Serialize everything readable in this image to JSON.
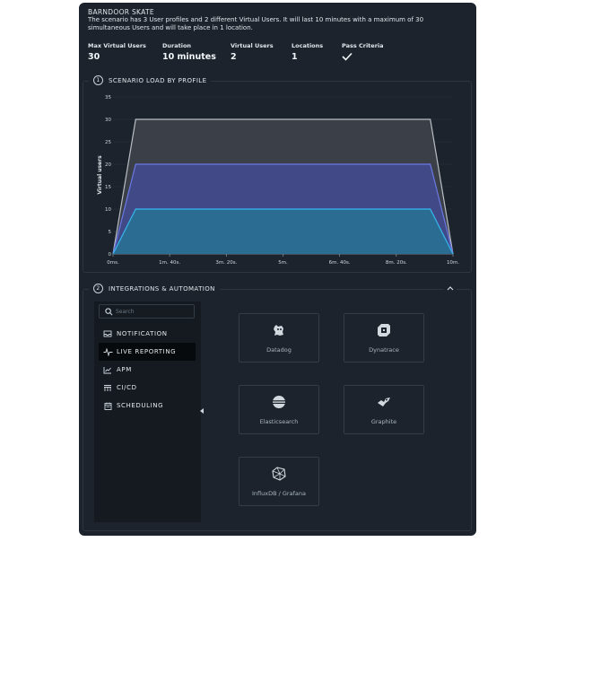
{
  "scenario": {
    "title": "BARNDOOR SKATE",
    "description": "The scenario has 3 User profiles and 2 different Virtual Users. It will last 10 minutes with a maximum of 30 simultaneous Users and will take place in 1 location."
  },
  "stats": [
    {
      "label": "Max Virtual Users",
      "value": "30"
    },
    {
      "label": "Duration",
      "value": "10 minutes"
    },
    {
      "label": "Virtual Users",
      "value": "2"
    },
    {
      "label": "Locations",
      "value": "1"
    },
    {
      "label": "Pass Criteria",
      "value": "",
      "icon": "checkmark-icon"
    }
  ],
  "load_section": {
    "number": "1",
    "title": "SCENARIO LOAD BY PROFILE"
  },
  "chart_data": {
    "type": "area",
    "ylabel": "Virtual users",
    "xlabel": "",
    "x": [
      0,
      40,
      560,
      600
    ],
    "x_ticks": [
      "0ms.",
      "1m. 40s.",
      "3m. 20s.",
      "5m.",
      "6m. 40s.",
      "8m. 20s.",
      "10m."
    ],
    "y_ticks": [
      "0",
      "5",
      "10",
      "15",
      "20",
      "25",
      "30",
      "35"
    ],
    "ylim": [
      0,
      35
    ],
    "xlim": [
      0,
      600
    ],
    "grid": true,
    "stacked": true,
    "series": [
      {
        "values": [
          0,
          10,
          10,
          0
        ],
        "color": "#2e9fd6"
      },
      {
        "values": [
          0,
          10,
          10,
          0
        ],
        "color": "#5c6bd6"
      },
      {
        "values": [
          0,
          10,
          10,
          0
        ],
        "color": "#9aa1aa"
      }
    ]
  },
  "integrations_section": {
    "number": "2",
    "title": "INTEGRATIONS & AUTOMATION",
    "collapse_icon": "chevron-up-icon"
  },
  "search": {
    "placeholder": "Search"
  },
  "nav": [
    {
      "label": "NOTIFICATION",
      "icon": "notification-icon",
      "active": false
    },
    {
      "label": "LIVE REPORTING",
      "icon": "pulse-icon",
      "active": true
    },
    {
      "label": "APM",
      "icon": "chart-icon",
      "active": false
    },
    {
      "label": "CI/CD",
      "icon": "pipeline-icon",
      "active": false
    },
    {
      "label": "SCHEDULING",
      "icon": "calendar-icon",
      "active": false
    }
  ],
  "integrations": [
    {
      "label": "Datadog",
      "icon": "datadog-icon"
    },
    {
      "label": "Dynatrace",
      "icon": "dynatrace-icon"
    },
    {
      "label": "Elasticsearch",
      "icon": "elasticsearch-icon"
    },
    {
      "label": "Graphite",
      "icon": "graphite-icon"
    },
    {
      "label": "InfluxDB / Grafana",
      "icon": "influxdb-icon"
    }
  ],
  "colors": {
    "panel": "#1c232c",
    "nav_panel": "#141a20",
    "active_nav": "#070a0d"
  }
}
